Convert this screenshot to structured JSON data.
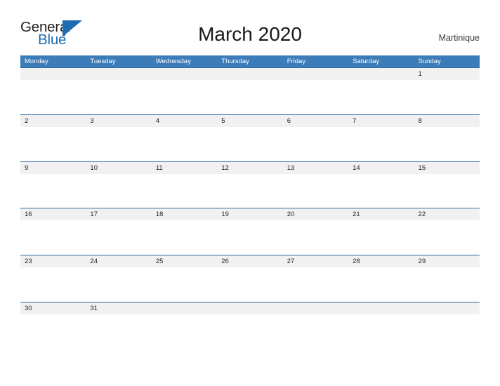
{
  "brand": {
    "name_part1": "General",
    "name_part2": "Blue",
    "mark_icon": "triangle-flag-icon",
    "color_dark": "#231f20",
    "color_blue": "#1f6cb0"
  },
  "header": {
    "title": "March 2020",
    "locale": "Martinique"
  },
  "calendar": {
    "accent_color": "#3c7cb8",
    "row_border_color": "#2e6da4",
    "number_band_color": "#f1f1f1",
    "weekday_headers": [
      "Monday",
      "Tuesday",
      "Wednesday",
      "Thursday",
      "Friday",
      "Saturday",
      "Sunday"
    ],
    "weeks": [
      [
        "",
        "",
        "",
        "",
        "",
        "",
        "1"
      ],
      [
        "2",
        "3",
        "4",
        "5",
        "6",
        "7",
        "8"
      ],
      [
        "9",
        "10",
        "11",
        "12",
        "13",
        "14",
        "15"
      ],
      [
        "16",
        "17",
        "18",
        "19",
        "20",
        "21",
        "22"
      ],
      [
        "23",
        "24",
        "25",
        "26",
        "27",
        "28",
        "29"
      ],
      [
        "30",
        "31",
        "",
        "",
        "",
        "",
        ""
      ]
    ]
  }
}
